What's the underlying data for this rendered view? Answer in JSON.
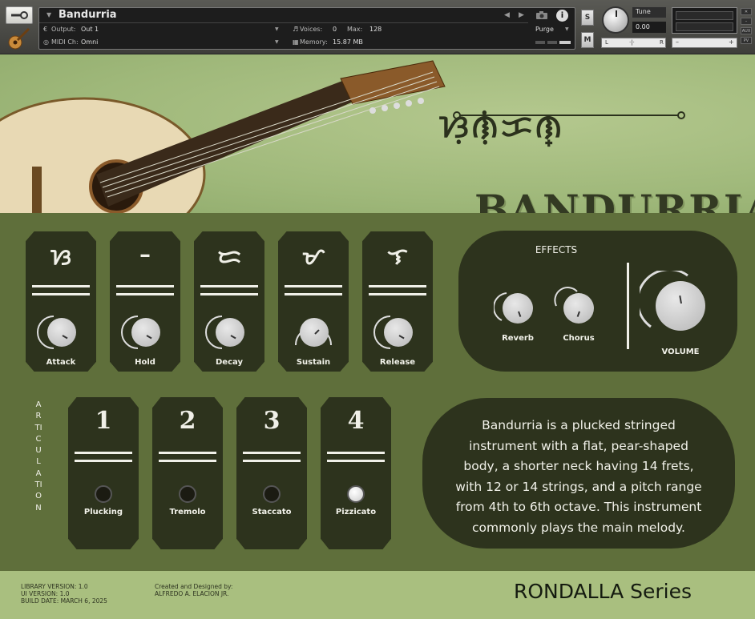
{
  "header": {
    "instrument_name": "Bandurria",
    "output_label": "Output:",
    "output_value": "Out 1",
    "midi_label": "MIDI Ch:",
    "midi_value": "Omni",
    "voices_label": "Voices:",
    "voices_value": "0",
    "max_label": "Max:",
    "max_value": "128",
    "memory_label": "Memory:",
    "memory_value": "15.87 MB",
    "purge_label": "Purge",
    "solo_label": "S",
    "mute_label": "M",
    "tune_label": "Tune",
    "tune_value": "0.00",
    "pan_left": "L",
    "pan_center": "·|·",
    "pan_right": "R",
    "vol_minus": "–",
    "vol_plus": "+",
    "aux_label": "AUX",
    "pv_label": "PV"
  },
  "art": {
    "script_title": "ᜐᜓᜈᜓᜒᜃᜈ᜔",
    "title": "BANDURRIA"
  },
  "envelope": [
    {
      "glyph": "ᜐ",
      "label": "Attack"
    },
    {
      "glyph": "–",
      "label": "Hold"
    },
    {
      "glyph": "ᜇ",
      "label": "Decay"
    },
    {
      "glyph": "ᜋ",
      "label": "Sustain"
    },
    {
      "glyph": "ᜎ",
      "label": "Release"
    }
  ],
  "effects": {
    "title": "EFFECTS",
    "reverb_label": "Reverb",
    "chorus_label": "Chorus",
    "volume_label": "VOLUME"
  },
  "articulation": {
    "side_label": "ARTICULATION",
    "items": [
      {
        "number": "1",
        "label": "Plucking",
        "active": false
      },
      {
        "number": "2",
        "label": "Tremolo",
        "active": false
      },
      {
        "number": "3",
        "label": "Staccato",
        "active": false
      },
      {
        "number": "4",
        "label": "Pizzicato",
        "active": true
      }
    ]
  },
  "description": "Bandurria is a plucked stringed instrument with a flat, pear-shaped body, a shorter neck having 14 frets, with 12 or 14 strings, and a pitch range from 4th to 6th octave. This instrument commonly plays the main melody.",
  "footer": {
    "library_version": "LIBRARY VERSION: 1.0",
    "ui_version": "UI VERSION: 1.0",
    "build_date": "BUILD DATE: MARCH 6, 2025",
    "credit_line1": "Created and Designed by:",
    "credit_line2": "ALFREDO A. ELACION JR.",
    "series": "RONDALLA Series"
  },
  "colors": {
    "panel_dark": "#2d331d",
    "panel_green": "#5f6f3b",
    "art_green": "#9fb87a"
  }
}
